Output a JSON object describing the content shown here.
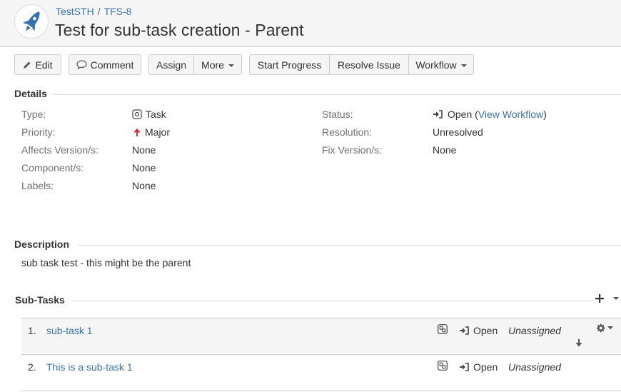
{
  "header": {
    "breadcrumb": {
      "project": "TestSTH",
      "separator": "/",
      "issue_key": "TFS-8"
    },
    "title": "Test for sub-task creation - Parent"
  },
  "toolbar": {
    "edit": "Edit",
    "comment": "Comment",
    "assign": "Assign",
    "more": "More",
    "start_progress": "Start Progress",
    "resolve_issue": "Resolve Issue",
    "workflow": "Workflow"
  },
  "details": {
    "heading": "Details",
    "left": [
      {
        "label": "Type:",
        "value": "Task",
        "icon": "task-type-icon"
      },
      {
        "label": "Priority:",
        "value": "Major",
        "icon": "priority-major-icon"
      },
      {
        "label": "Affects Version/s:",
        "value": "None"
      },
      {
        "label": "Component/s:",
        "value": "None"
      },
      {
        "label": "Labels:",
        "value": "None"
      }
    ],
    "right": [
      {
        "label": "Status:",
        "value": "Open",
        "link_open": "(",
        "link": "View Workflow",
        "link_close": ")"
      },
      {
        "label": "Resolution:",
        "value": "Unresolved"
      },
      {
        "label": "Fix Version/s:",
        "value": "None"
      }
    ]
  },
  "description": {
    "heading": "Description",
    "text": "sub task test - this might be the parent"
  },
  "subtasks": {
    "heading": "Sub-Tasks",
    "items": [
      {
        "num": "1.",
        "summary": "sub-task 1",
        "status": "Open",
        "assignee": "Unassigned"
      },
      {
        "num": "2.",
        "summary": "This is a sub-task 1",
        "status": "Open",
        "assignee": "Unassigned"
      }
    ]
  },
  "colors": {
    "link": "#3b73af",
    "priority_major": "#cc3333",
    "header_bg": "#f5f5f5"
  }
}
